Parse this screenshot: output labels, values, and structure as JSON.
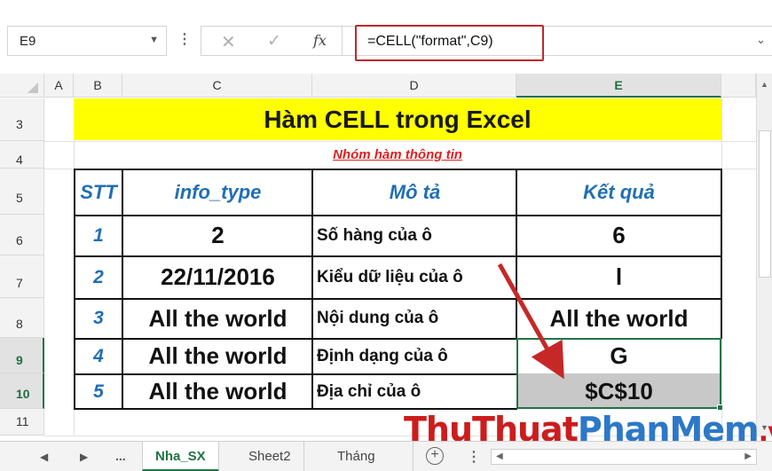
{
  "formula_bar": {
    "name_box": "E9",
    "more": "⋮",
    "cancel_icon": "✕",
    "enter_icon": "✓",
    "fx_label": "fx",
    "formula": "=CELL(\"format\",C9)",
    "expand_icon": "chevron-down"
  },
  "columns": [
    "A",
    "B",
    "C",
    "D",
    "E"
  ],
  "selected_column": "E",
  "rows": [
    "3",
    "4",
    "5",
    "6",
    "7",
    "8",
    "9",
    "10",
    "11"
  ],
  "selected_rows": [
    "9",
    "10"
  ],
  "sheet": {
    "title": "Hàm CELL trong Excel",
    "subtitle": "Nhóm hàm thông tin",
    "title_fill": "#ffff00",
    "table_headers": [
      "STT",
      "info_type",
      "Mô tả",
      "Kết quả"
    ],
    "table_rows": [
      {
        "stt": "1",
        "info_type": "2",
        "desc": "Số hàng của ô",
        "result": "6"
      },
      {
        "stt": "2",
        "info_type": "22/11/2016",
        "desc": "Kiểu dữ liệu của ô",
        "result": "l"
      },
      {
        "stt": "3",
        "info_type": "All the world",
        "desc": "Nội dung của ô",
        "result": "All the world"
      },
      {
        "stt": "4",
        "info_type": "All the world",
        "desc": "Định dạng của ô",
        "result": "G"
      },
      {
        "stt": "5",
        "info_type": "All the world",
        "desc": "Địa chỉ của ô",
        "result": "$C$10"
      }
    ]
  },
  "watermark": {
    "part1": "Thu",
    "part2": "Thuat",
    "part3": "PhanMem",
    "part4": ".vn"
  },
  "tabs": {
    "nav_prev": "◀",
    "nav_next": "▶",
    "nav_more": "...",
    "items": [
      "Nha_SX",
      "Sheet2",
      "Tháng"
    ],
    "active": "Nha_SX",
    "add_label": "+",
    "separator": "⋮"
  },
  "colors": {
    "accent": "#217346",
    "header_blue": "#1f6fb5",
    "highlight_red": "#c0272d"
  }
}
